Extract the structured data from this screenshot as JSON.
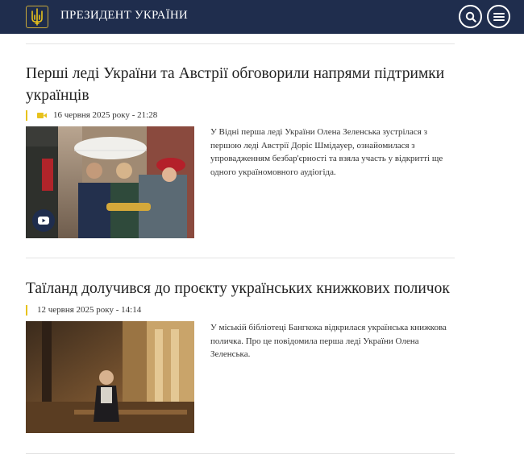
{
  "header": {
    "title": "ПРЕЗИДЕНТ УКРАЇНИ",
    "logo_icon": "trident-icon",
    "search_icon": "search-icon",
    "menu_icon": "menu-icon",
    "bg_color": "#1f2d4d",
    "accent_color": "#c9a93a"
  },
  "articles": [
    {
      "title": "Перші леді України та Австрії обговорили напрями підтримки українців",
      "date": "16 червня 2025 року - 21:28",
      "has_video": true,
      "media_icon": "video-camera-icon",
      "description": "У Відні перша леді України Олена Зеленська зустрілася з першою леді Австрії Доріс Шмідауер, ознайомилася з упровадженням безбар'єрності та взяла участь у відкритті ще одного україномовного аудіогіда."
    },
    {
      "title": "Таїланд долучився до проєкту українських книжкових поличок",
      "date": "12 червня 2025 року - 14:14",
      "has_video": false,
      "description": "У міській бібліотеці Бангкока відкрилася українська книжкова поличка. Про це повідомила перша леді України Олена Зеленська."
    }
  ],
  "colors": {
    "date_marker": "#e7c21c"
  }
}
